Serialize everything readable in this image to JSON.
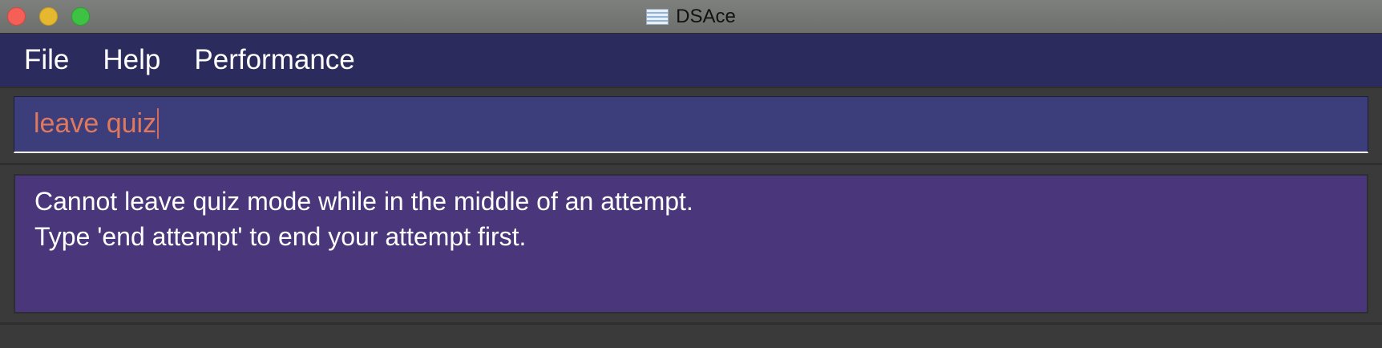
{
  "window": {
    "title": "DSAce",
    "app_icon": "app-icon"
  },
  "menu": {
    "items": [
      {
        "label": "File"
      },
      {
        "label": "Help"
      },
      {
        "label": "Performance"
      }
    ]
  },
  "command_box": {
    "value": "leave quiz"
  },
  "result_display": {
    "lines": [
      "Cannot leave quiz mode while in the middle of an attempt.",
      "Type 'end attempt' to end your attempt first."
    ]
  },
  "colors": {
    "menu_bar": "#2c2b5e",
    "command_box": "#3c3e7c",
    "command_text": "#e0785e",
    "result_box": "#4a367a"
  }
}
